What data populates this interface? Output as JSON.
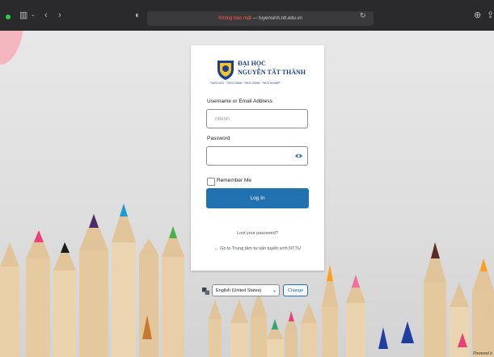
{
  "browser": {
    "url_warning": "Không bảo mật",
    "url_text": "— tuyensinh.ntt.edu.vn",
    "icons": [
      "sidebar-icon",
      "back-icon",
      "forward-icon",
      "shield-icon",
      "reload-icon",
      "download-icon",
      "share-icon"
    ]
  },
  "logo": {
    "line1": "ĐẠI HỌC",
    "line2": "NGUYỄN TẤT THÀNH",
    "tagline": "THỰC HỌC · THỰC HÀNH · THỰC DANH · THỰC NGHIỆP"
  },
  "form": {
    "username_label": "Username or Email Address",
    "username_value": "ntbinh",
    "password_label": "Password",
    "remember_label": "Remember Me",
    "login_button": "Log In"
  },
  "links": {
    "lost_password": "Lost your password?",
    "go_to": "← Go to Trung tâm tư vấn tuyển sinh NTTU"
  },
  "language": {
    "selected": "English (United States)",
    "change_button": "Change"
  },
  "footer": {
    "powered": "Powered b"
  },
  "colors": {
    "accent": "#2271b1",
    "brand": "#1b3f8f",
    "warning": "#ff5a4a"
  }
}
